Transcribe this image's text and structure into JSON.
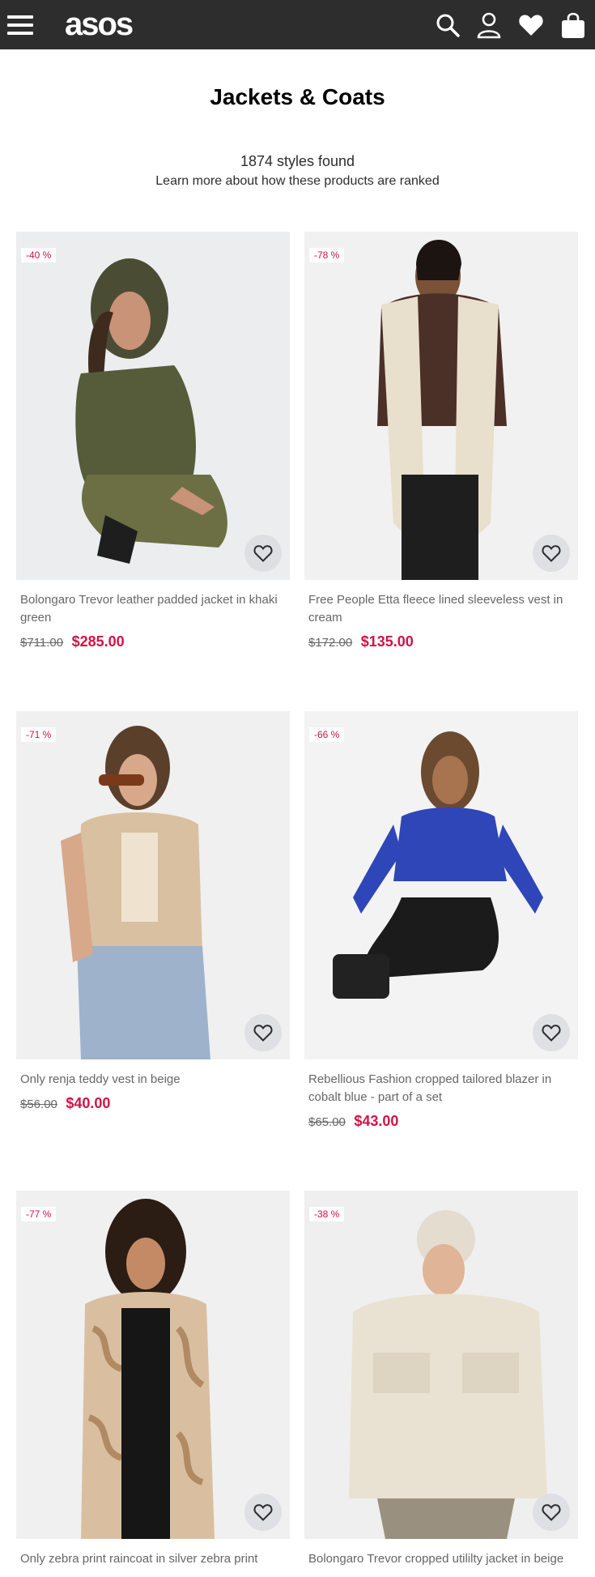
{
  "header": {
    "logo": "asos",
    "icons": [
      "menu-icon",
      "search-icon",
      "account-icon",
      "heart-icon",
      "bag-icon"
    ],
    "background": "#2d2d2d"
  },
  "page": {
    "title": "Jackets & Coats",
    "styles_found": "1874 styles found",
    "ranking_link": "Learn more about how these products are ranked"
  },
  "products": [
    {
      "badge": "-40 %",
      "name": "Bolongaro Trevor leather padded jacket in khaki green",
      "old_price": "$711.00",
      "price": "$285.00"
    },
    {
      "badge": "-78 %",
      "name": "Free People Etta fleece lined sleeveless vest in cream",
      "old_price": "$172.00",
      "price": "$135.00"
    },
    {
      "badge": "-71 %",
      "name": "Only renja teddy vest in beige",
      "old_price": "$56.00",
      "price": "$40.00"
    },
    {
      "badge": "-66 %",
      "name": "Rebellious Fashion cropped tailored blazer in cobalt blue - part of a set",
      "old_price": "$65.00",
      "price": "$43.00"
    },
    {
      "badge": "-77 %",
      "name": "Only zebra print raincoat in silver zebra print",
      "old_price": "",
      "price": ""
    },
    {
      "badge": "-38 %",
      "name": "Bolongaro Trevor cropped utililty jacket in beige",
      "old_price": "",
      "price": ""
    }
  ],
  "colors": {
    "sale": "#d01345",
    "image_bg": "#ecedee"
  }
}
